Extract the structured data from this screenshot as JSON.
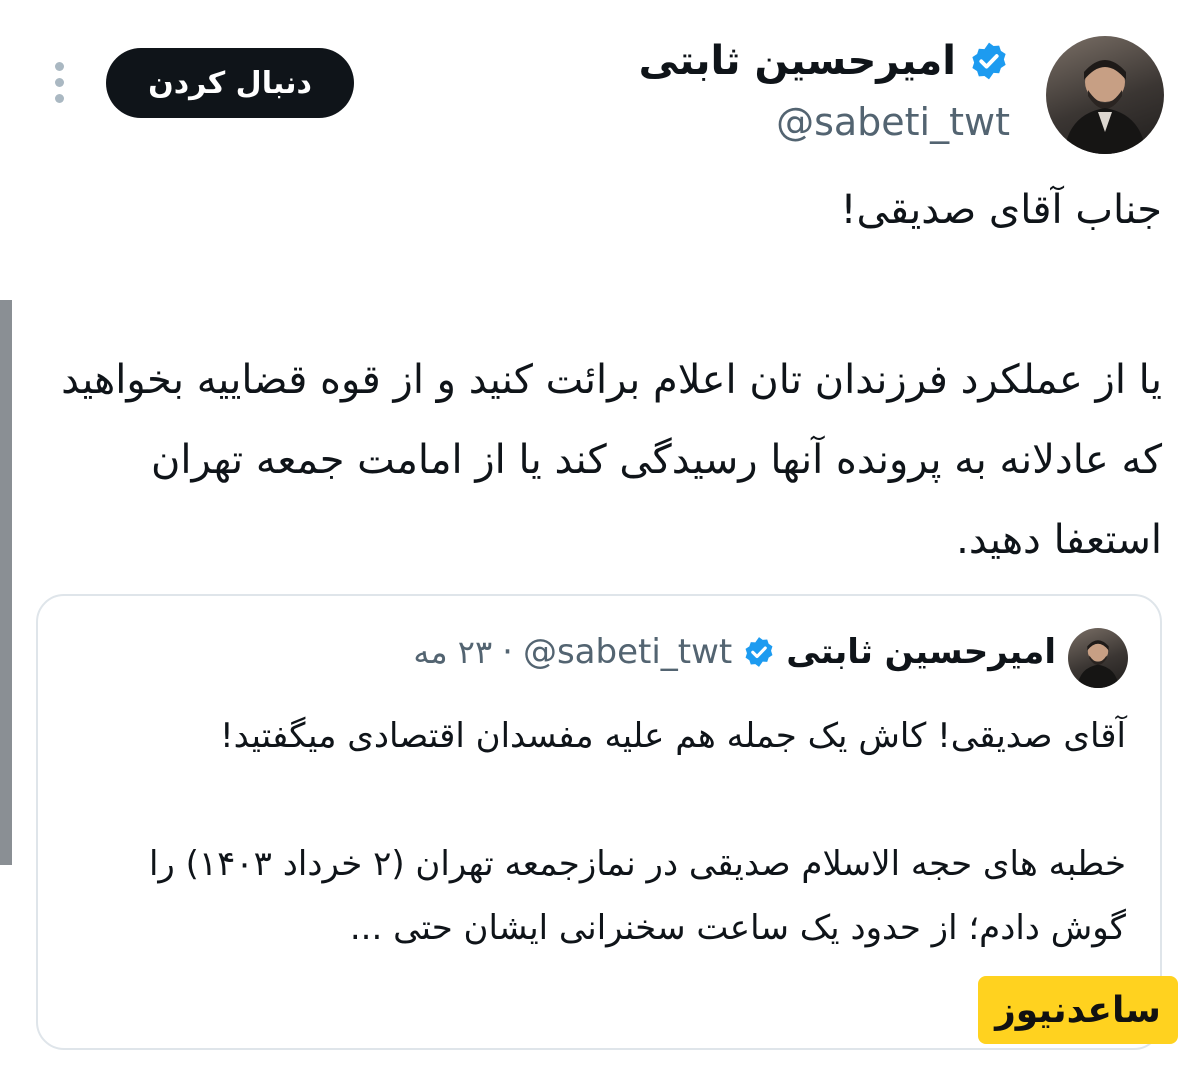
{
  "author": {
    "display_name": "امیرحسین ثابتی",
    "handle": "@sabeti_twt",
    "verified": true
  },
  "actions": {
    "follow_label": "دنبال کردن"
  },
  "tweet": {
    "greeting": "جناب آقای صدیقی!",
    "body": "یا از عملکرد فرزندان تان اعلام برائت کنید و از قوه قضاییه بخواهید که عادلانه به پرونده آنها رسیدگی کند یا از امامت جمعه تهران استعفا دهید."
  },
  "quoted_tweet": {
    "display_name": "امیرحسین ثابتی",
    "handle": "@sabeti_twt",
    "separator": "·",
    "date": "۲۳ مه",
    "paragraph_1": "آقای صدیقی! کاش یک جمله هم علیه مفسدان اقتصادی میگفتید!",
    "paragraph_2": "خطبه های حجه الاسلام صدیقی در نمازجمعه تهران (۲ خرداد ۱۴۰۳) را گوش دادم؛ از حدود یک ساعت سخنرانی ایشان حتی ..."
  },
  "watermark": {
    "text": "ساعدنیوز"
  },
  "colors": {
    "verified_blue": "#1d9bf0",
    "follow_button_bg": "#0f1419",
    "secondary_text": "#536471",
    "watermark_bg": "#ffd21f"
  },
  "icons": {
    "verified": "verified-badge-icon",
    "more": "more-vertical-icon"
  }
}
